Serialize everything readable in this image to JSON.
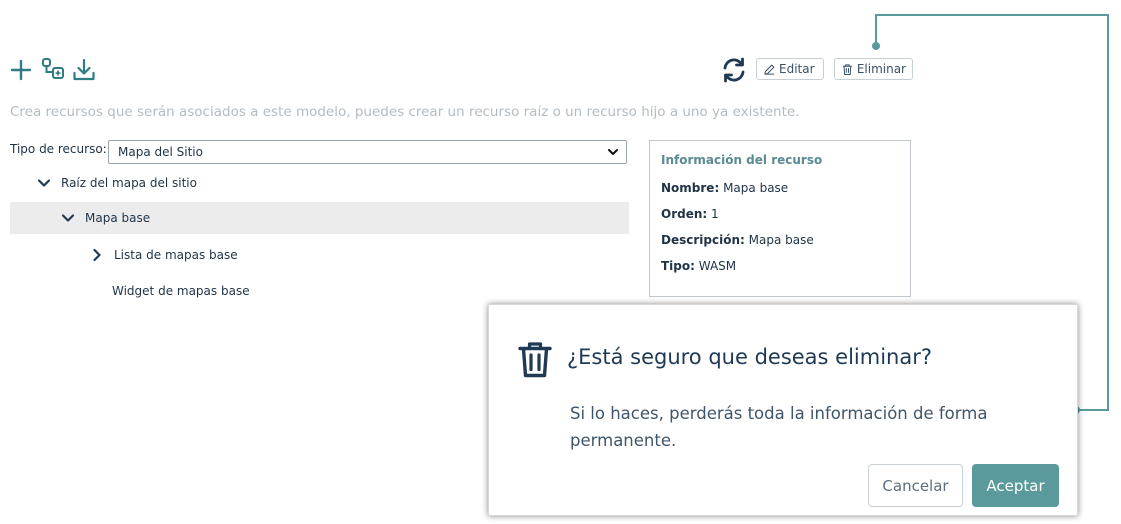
{
  "toolbar": {
    "add_icon": "plus-icon",
    "add_child_icon": "add-child-resource-icon",
    "download_icon": "download-icon",
    "refresh_icon": "refresh-icon",
    "edit_label": "Editar",
    "delete_label": "Eliminar"
  },
  "hint": "Crea recursos que serán asociados a este modelo, puedes crear un recurso raíz o un recurso hijo a uno ya existente.",
  "resource_type": {
    "label": "Tipo de recurso:",
    "selected": "Mapa del Sitio"
  },
  "tree": {
    "root": "Raíz del mapa del sitio",
    "child": "Mapa base",
    "grandchild_1": "Lista de mapas base",
    "grandchild_2": "Widget de mapas base"
  },
  "info": {
    "title": "Información del recurso",
    "name_label": "Nombre:",
    "name_value": "Mapa base",
    "order_label": "Orden:",
    "order_value": "1",
    "desc_label": "Descripción:",
    "desc_value": "Mapa base",
    "type_label": "Tipo:",
    "type_value": "WASM"
  },
  "modal": {
    "title": "¿Está seguro que deseas eliminar?",
    "body": "Si lo haces, perderás toda la información de forma permanente.",
    "cancel_label": "Cancelar",
    "accept_label": "Aceptar"
  },
  "colors": {
    "accent": "#5b9a9c",
    "navy": "#1f3a55",
    "connector": "#5b9a9c"
  }
}
